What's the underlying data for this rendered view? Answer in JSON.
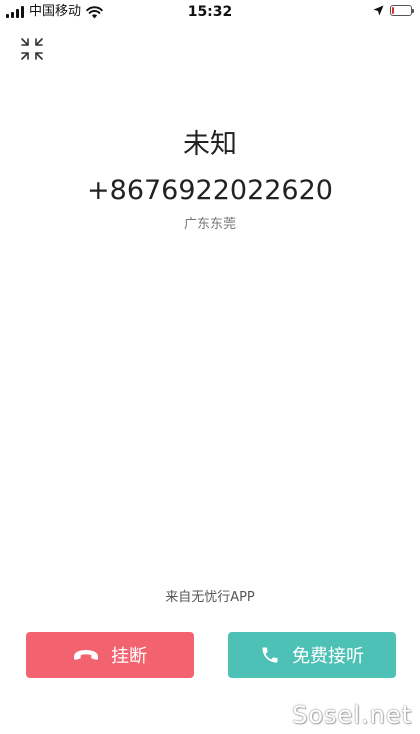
{
  "status_bar": {
    "carrier": "中国移动",
    "time": "15:32",
    "battery_level": 0.1
  },
  "call": {
    "name": "未知",
    "number": "+8676922022620",
    "location": "广东东莞"
  },
  "source_text": "来自无忧行APP",
  "buttons": {
    "hangup_label": "挂断",
    "answer_label": "免费接听"
  },
  "watermark": "Sosel.net",
  "colors": {
    "hangup": "#f2636f",
    "answer": "#4ec1b6",
    "battery_low": "#e02b2b"
  },
  "icons": {
    "minimize": "minimize-icon",
    "hangup": "phone-hangup-icon",
    "answer": "phone-icon"
  }
}
